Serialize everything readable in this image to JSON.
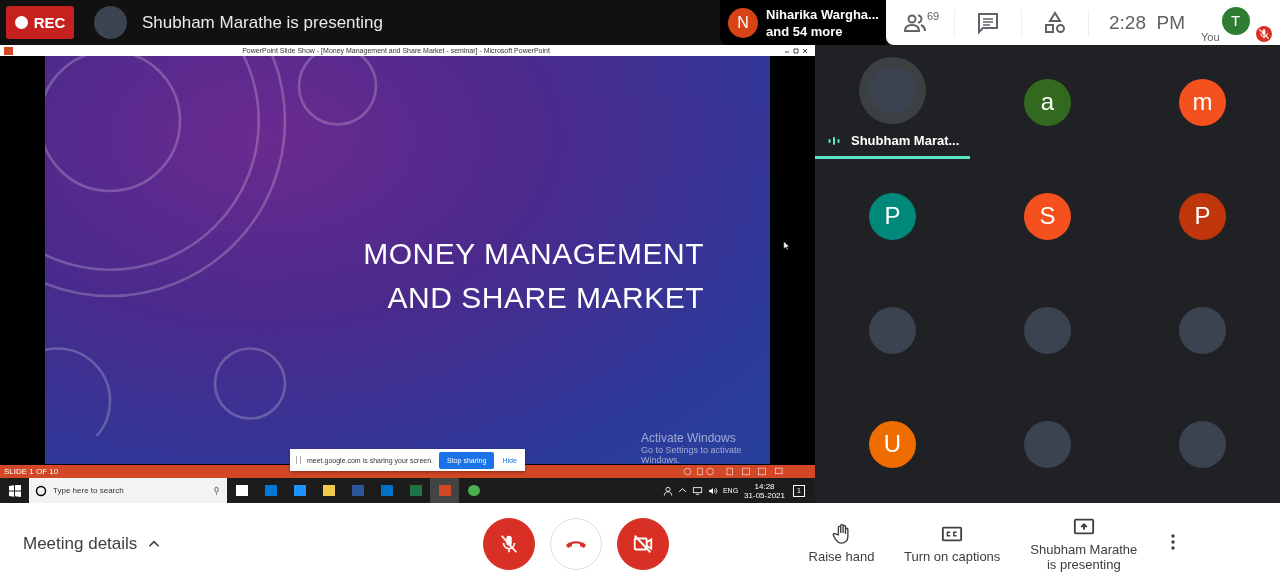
{
  "top_bar": {
    "recording": {
      "label": "REC",
      "on": true
    },
    "presenter_title": "Shubham Marathe is presenting",
    "participants_preview": {
      "initial": "N",
      "color": "#d84315",
      "name": "Niharika Wargha...",
      "more": "and 54 more"
    },
    "people_count": "69",
    "time": "2:28  PM",
    "self": {
      "label": "You",
      "initial": "T",
      "color": "#2e7d32",
      "muted": true
    }
  },
  "shared_screen": {
    "window_title": "PowerPoint Slide Show - [Money Management and Share Market - seminar] - Microsoft PowerPoint",
    "slide_title": [
      "MONEY MANAGEMENT",
      "AND SHARE MARKET"
    ],
    "activation": {
      "title": "Activate Windows",
      "subtitle": "Go to Settings to activate Windows."
    },
    "slide_counter": "SLIDE 1 OF 10",
    "share_banner": {
      "message": "meet.google.com is sharing your screen.",
      "stop": "Stop sharing",
      "hide": "Hide"
    },
    "taskbar": {
      "search_placeholder": "Type here to search",
      "lang": "ENG",
      "clock_time": "14:28",
      "clock_date": "31-05-2021",
      "notifications": "1"
    }
  },
  "tiles": [
    {
      "kind": "photo",
      "name": "Shubham Marat...",
      "speaking": true
    },
    {
      "kind": "initial",
      "initial": "a",
      "color": "#33691e",
      "speaking": false
    },
    {
      "kind": "initial",
      "initial": "m",
      "color": "#f4511e",
      "speaking": false
    },
    {
      "kind": "initial",
      "initial": "P",
      "color": "#00897b",
      "speaking": false
    },
    {
      "kind": "initial",
      "initial": "S",
      "color": "#f4511e",
      "speaking": false
    },
    {
      "kind": "initial",
      "initial": "P",
      "color": "#bf360c",
      "speaking": false
    },
    {
      "kind": "photo",
      "speaking": false
    },
    {
      "kind": "photo",
      "speaking": false
    },
    {
      "kind": "photo",
      "speaking": false
    },
    {
      "kind": "initial",
      "initial": "U",
      "color": "#ef6c00",
      "speaking": false
    },
    {
      "kind": "photo",
      "speaking": false
    },
    {
      "kind": "photo",
      "speaking": false
    }
  ],
  "bottom_bar": {
    "meeting_details": "Meeting details",
    "mic_on": false,
    "camera_on": false,
    "actions": [
      {
        "kind": "hand",
        "label": "Raise hand"
      },
      {
        "kind": "captions",
        "label": "Turn on captions"
      },
      {
        "kind": "present",
        "label": "Shubham Marathe\nis presenting"
      }
    ]
  }
}
